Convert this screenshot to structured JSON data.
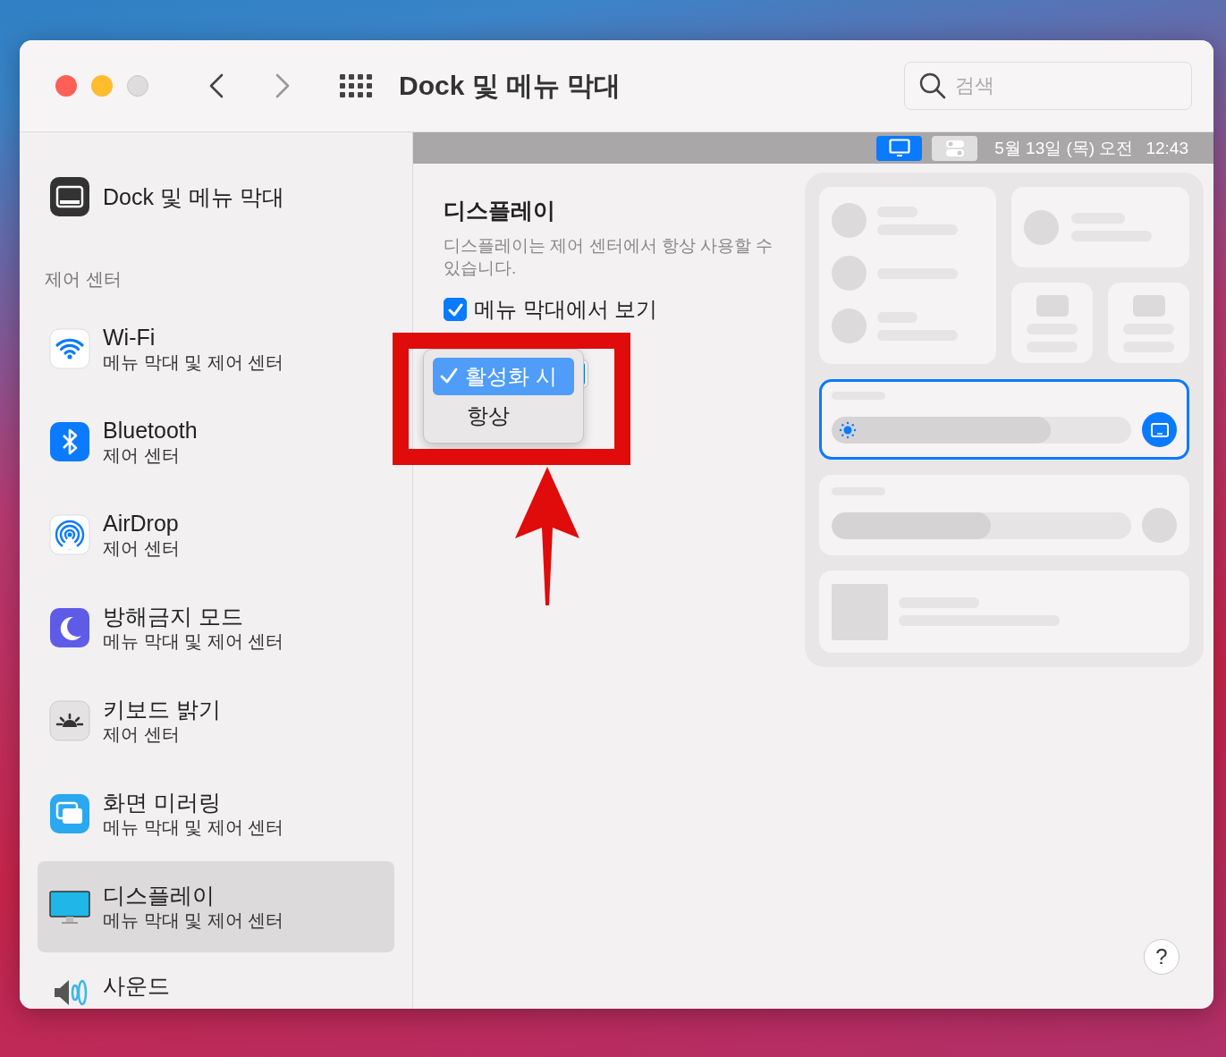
{
  "window": {
    "title": "Dock 및 메뉴 막대"
  },
  "search": {
    "placeholder": "검색"
  },
  "sidebar": {
    "top_item": {
      "label": "Dock 및 메뉴 막대",
      "kind": "dock"
    },
    "section": "제어 센터",
    "items": [
      {
        "label": "Wi-Fi",
        "subtitle": "메뉴 막대 및 제어 센터",
        "kind": "wifi",
        "selected": false
      },
      {
        "label": "Bluetooth",
        "subtitle": "제어 센터",
        "kind": "bluetooth",
        "selected": false
      },
      {
        "label": "AirDrop",
        "subtitle": "제어 센터",
        "kind": "airdrop",
        "selected": false
      },
      {
        "label": "방해금지 모드",
        "subtitle": "메뉴 막대 및 제어 센터",
        "kind": "focus",
        "selected": false
      },
      {
        "label": "키보드 밝기",
        "subtitle": "제어 센터",
        "kind": "keyboard",
        "selected": false
      },
      {
        "label": "화면 미러링",
        "subtitle": "메뉴 막대 및 제어 센터",
        "kind": "mirroring",
        "selected": false
      },
      {
        "label": "디스플레이",
        "subtitle": "메뉴 막대 및 제어 센터",
        "kind": "display",
        "selected": true
      },
      {
        "label": "사운드",
        "kind": "sound",
        "selected": false
      }
    ]
  },
  "menubar_preview": {
    "items": [
      {
        "kind": "display",
        "selected": true
      },
      {
        "kind": "controls",
        "selected": false
      }
    ],
    "date": "5월 13일 (목) 오전",
    "time": "12:43"
  },
  "detail": {
    "title": "디스플레이",
    "description": "디스플레이는 제어 센터에서 항상 사용할 수 있습니다.",
    "checkbox": {
      "label": "메뉴 막대에서 보기",
      "checked": true
    },
    "popup_menu": {
      "options": [
        {
          "label": "활성화 시",
          "selected": true
        },
        {
          "label": "항상",
          "selected": false
        }
      ]
    }
  },
  "preview": {
    "sliders": [
      {
        "kind": "brightness",
        "highlighted": true,
        "level": 0.73
      },
      {
        "kind": "plain",
        "highlighted": false,
        "level": 0.53
      }
    ]
  },
  "help": {
    "label": "?"
  }
}
